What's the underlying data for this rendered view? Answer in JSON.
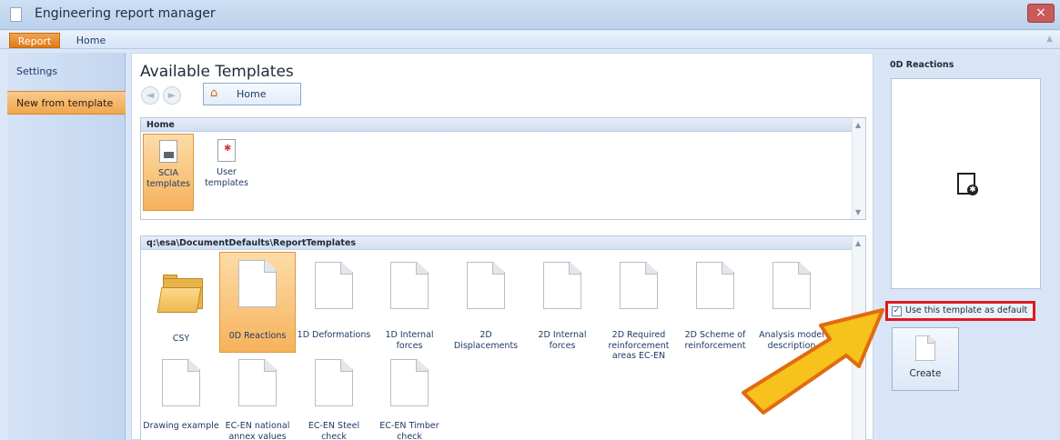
{
  "window": {
    "title": "Engineering report manager",
    "close_glyph": "×"
  },
  "menubar": {
    "tabs": [
      {
        "label": "Report"
      },
      {
        "label": "Home"
      }
    ],
    "collapse_glyph": "▲"
  },
  "sidebar": {
    "items": [
      {
        "label": "Settings"
      },
      {
        "label": "New from template"
      }
    ]
  },
  "main": {
    "title": "Available Templates",
    "nav": {
      "back_glyph": "◄",
      "forward_glyph": "►"
    },
    "breadcrumb": {
      "home_glyph": "⌂",
      "label": "Home"
    },
    "home_panel": {
      "header": "Home",
      "items": [
        {
          "label": "SCIA templates"
        },
        {
          "label": "User templates"
        }
      ]
    },
    "templates_panel": {
      "header": "q:\\esa\\DocumentDefaults\\ReportTemplates",
      "items": [
        {
          "label": "CSY"
        },
        {
          "label": "0D Reactions"
        },
        {
          "label": "1D Deformations"
        },
        {
          "label": "1D Internal forces"
        },
        {
          "label": "2D Displacements"
        },
        {
          "label": "2D Internal forces"
        },
        {
          "label": "2D Required reinforcement areas EC-EN"
        },
        {
          "label": "2D Scheme of reinforcement"
        },
        {
          "label": "Analysis model description"
        },
        {
          "label": "Drawing example"
        },
        {
          "label": "EC-EN national annex values"
        },
        {
          "label": "EC-EN Steel check"
        },
        {
          "label": "EC-EN Timber check"
        }
      ]
    }
  },
  "right_panel": {
    "title": "0D Reactions",
    "use_default": {
      "label": "Use this template as default",
      "checked": true,
      "check_glyph": "✓"
    },
    "create_label": "Create",
    "preview_glyph": "✱"
  },
  "icons": {
    "app": "document-icon",
    "home": "home-icon",
    "folder": "folder-icon",
    "template": "document-icon",
    "preview": "document-gear-icon",
    "annotation": "yellow-arrow"
  },
  "colors": {
    "accent_orange": "#f1a64e",
    "highlight_red": "#e0191e",
    "arrow_yellow": "#f7c21b"
  }
}
